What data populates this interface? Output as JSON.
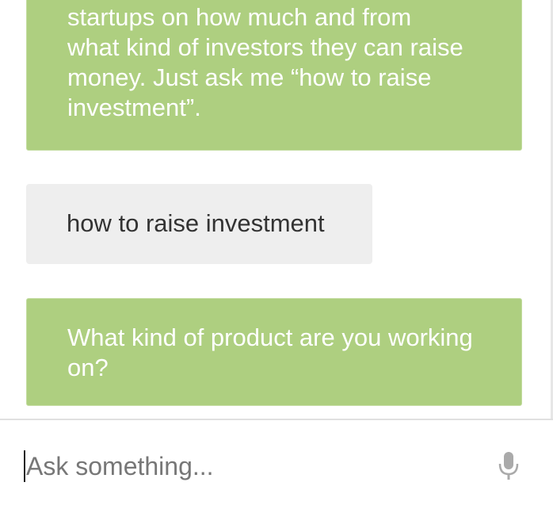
{
  "conversation": {
    "messages": [
      {
        "role": "bot",
        "lines": [
          "startups on how much and from",
          "what kind of investors they can raise",
          "money. Just ask me “how to raise",
          "investment”."
        ]
      },
      {
        "role": "user",
        "text": "how to raise investment"
      },
      {
        "role": "bot",
        "lines": [
          "What kind of product are you working",
          "on?"
        ]
      }
    ]
  },
  "input": {
    "placeholder": "Ask something...",
    "value": ""
  },
  "icons": {
    "mic": "microphone-icon"
  },
  "colors": {
    "bot_bubble": "#aecf80",
    "user_bubble": "#eeeeee",
    "mic": "#aaaaaa"
  }
}
